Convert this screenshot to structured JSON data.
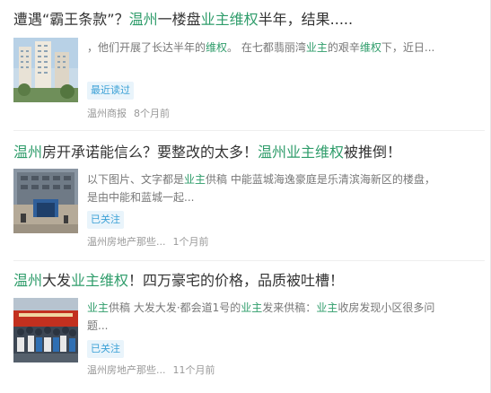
{
  "items": [
    {
      "title_parts": [
        {
          "text": "遭遇“霸王条款”？",
          "hl": false
        },
        {
          "text": "温州",
          "hl": true
        },
        {
          "text": "一楼盘",
          "hl": false
        },
        {
          "text": "业主维权",
          "hl": true
        },
        {
          "text": "半年，结果.....",
          "hl": false
        }
      ],
      "snippet_parts": [
        {
          "text": "，他们开展了长达半年的",
          "hl": false
        },
        {
          "text": "维权",
          "hl": true
        },
        {
          "text": "。 在七都翡丽湾",
          "hl": false
        },
        {
          "text": "业主",
          "hl": true
        },
        {
          "text": "的艰辛",
          "hl": false
        },
        {
          "text": "维权",
          "hl": true
        },
        {
          "text": "下，近日...",
          "hl": false
        }
      ],
      "badge": "最近读过",
      "source": "温州商报",
      "time": "8个月前",
      "thumb_icon": "apartment-building-photo"
    },
    {
      "title_parts": [
        {
          "text": "温州",
          "hl": true
        },
        {
          "text": "房开承诺能信么？要整改的太多！",
          "hl": false
        },
        {
          "text": "温州业主维权",
          "hl": true
        },
        {
          "text": "被推倒！",
          "hl": false
        }
      ],
      "snippet_parts": [
        {
          "text": "以下图片、文字都是",
          "hl": false
        },
        {
          "text": "业主",
          "hl": true
        },
        {
          "text": "供稿 中能蓝城海逸豪庭是乐清滨海新区的楼盘，是由中能和蓝城一起...",
          "hl": false
        }
      ],
      "badge": "已关注",
      "source": "温州房地产那些...",
      "time": "1个月前",
      "thumb_icon": "building-gate-photo"
    },
    {
      "title_parts": [
        {
          "text": "温州",
          "hl": true
        },
        {
          "text": "大发",
          "hl": false
        },
        {
          "text": "业主维权",
          "hl": true
        },
        {
          "text": "！四万豪宅的价格，品质被吐槽！",
          "hl": false
        }
      ],
      "snippet_parts": [
        {
          "text": "业主",
          "hl": true
        },
        {
          "text": "供稿 大发大发·都会道1号的",
          "hl": false
        },
        {
          "text": "业主",
          "hl": true
        },
        {
          "text": "发来供稿：",
          "hl": false
        },
        {
          "text": "业主",
          "hl": true
        },
        {
          "text": "收房发现小区很多问题...",
          "hl": false
        }
      ],
      "badge": "已关注",
      "source": "温州房地产那些...",
      "time": "11个月前",
      "thumb_icon": "protest-crowd-photo"
    }
  ],
  "colors": {
    "highlight": "#2e9c6a",
    "badge_text": "#3aa0d6",
    "badge_bg": "#e9f4fb",
    "meta": "#999999",
    "title": "#333333"
  }
}
